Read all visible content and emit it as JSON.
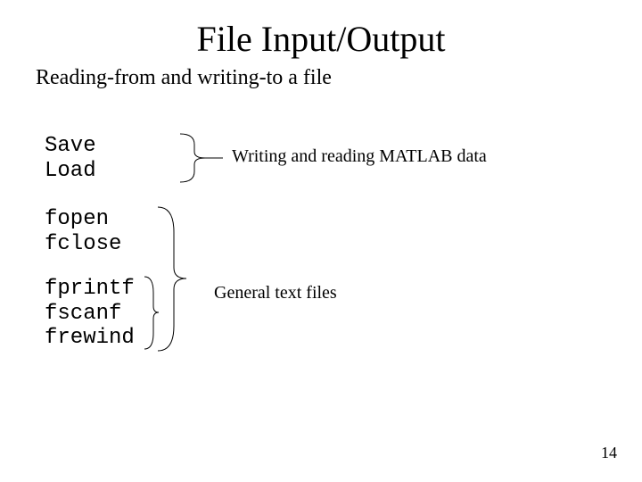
{
  "title": "File Input/Output",
  "subtitle": "Reading-from and writing-to a file",
  "groups": {
    "g1": {
      "line1": "Save",
      "line2": "Load"
    },
    "g2": {
      "line1": "fopen",
      "line2": "fclose"
    },
    "g3": {
      "line1": "fprintf",
      "line2": "fscanf",
      "line3": "frewind"
    }
  },
  "descriptions": {
    "d1": "Writing and reading MATLAB data",
    "d2": "General text files"
  },
  "page": "14"
}
